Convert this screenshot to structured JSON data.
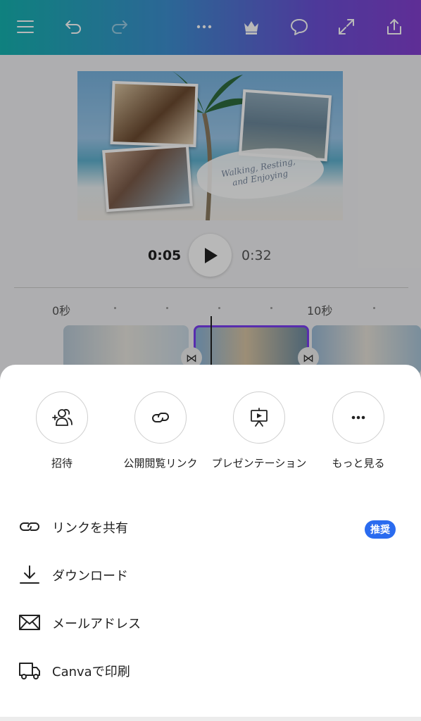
{
  "toolbar": {
    "icons": [
      "menu-icon",
      "undo-icon",
      "redo-icon",
      "more-icon",
      "crown-icon",
      "comment-icon",
      "expand-icon",
      "share-icon"
    ]
  },
  "design": {
    "script_text_line1": "Walking, Resting,",
    "script_text_line2": "and Enjoying"
  },
  "player": {
    "current_time": "0:05",
    "total_time": "0:32"
  },
  "timeline": {
    "label_start": "0秒",
    "label_10": "10秒"
  },
  "share_sheet": {
    "quick_actions": [
      {
        "label": "招待",
        "icon": "invite-people-icon"
      },
      {
        "label": "公開閲覧リンク",
        "icon": "link-icon"
      },
      {
        "label": "プレゼンテーション",
        "icon": "presentation-icon"
      },
      {
        "label": "もっと見る",
        "icon": "more-icon"
      }
    ],
    "options": [
      {
        "label": "リンクを共有",
        "icon": "link-icon",
        "badge": "推奨"
      },
      {
        "label": "ダウンロード",
        "icon": "download-icon"
      },
      {
        "label": "メールアドレス",
        "icon": "mail-icon"
      },
      {
        "label": "Canvaで印刷",
        "icon": "truck-icon"
      }
    ]
  },
  "colors": {
    "accent": "#7b3ff2",
    "badge": "#2a6bef"
  }
}
